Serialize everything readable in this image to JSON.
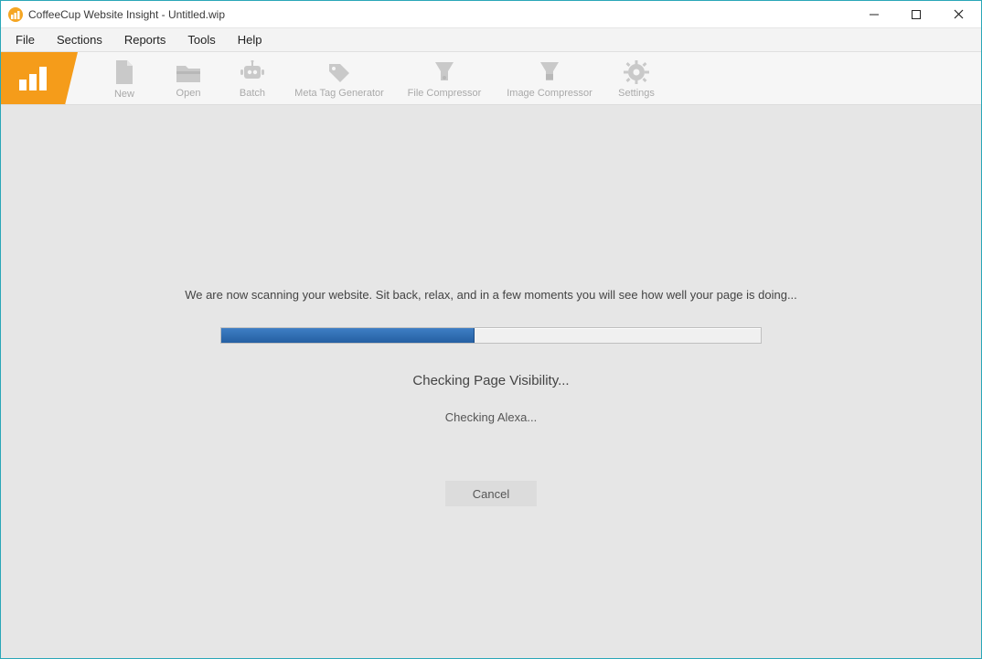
{
  "window": {
    "title": "CoffeeCup Website Insight - Untitled.wip"
  },
  "menu": {
    "file": "File",
    "sections": "Sections",
    "reports": "Reports",
    "tools": "Tools",
    "help": "Help"
  },
  "toolbar": {
    "new": "New",
    "open": "Open",
    "batch": "Batch",
    "meta": "Meta Tag Generator",
    "filecomp": "File Compressor",
    "imgcomp": "Image Compressor",
    "settings": "Settings"
  },
  "scan": {
    "message": "We are now scanning your website. Sit back, relax, and in a few moments you will see how well your page is doing...",
    "progress_percent": 47,
    "phase": "Checking Page Visibility...",
    "detail": "Checking Alexa...",
    "cancel_label": "Cancel"
  }
}
